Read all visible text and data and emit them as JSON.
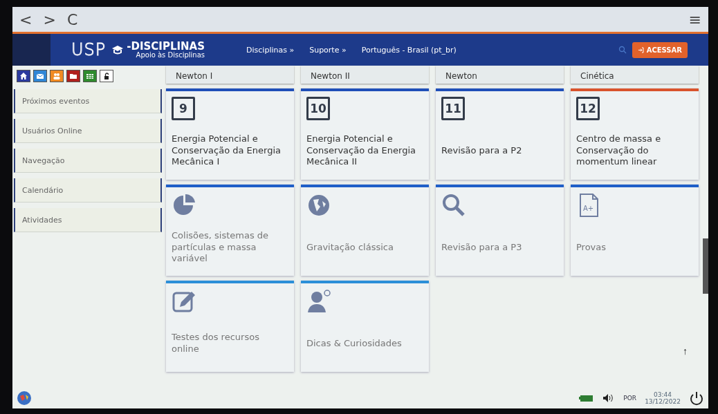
{
  "browser": {
    "back": "<",
    "forward": ">",
    "reload": "C",
    "menu": "≡"
  },
  "header": {
    "logo": "USP",
    "brand": "-DISCIPLINAS",
    "tagline": "Apoio às Disciplinas",
    "menu": [
      "Disciplinas »",
      "Suporte »",
      "Português - Brasil (pt_br)"
    ],
    "login": "ACESSAR"
  },
  "quick_buttons": [
    {
      "kind": "home",
      "color": "#2b3a9e"
    },
    {
      "kind": "mail",
      "color": "#2f86d6"
    },
    {
      "kind": "people",
      "color": "#f08a24"
    },
    {
      "kind": "folder",
      "color": "#b0201e"
    },
    {
      "kind": "table",
      "color": "#2e8b2e"
    },
    {
      "kind": "lock",
      "color": "#ffffff"
    }
  ],
  "sidebar": {
    "blocks": [
      "Próximos eventos",
      "Usuários Online",
      "Navegação",
      "Calendário",
      "Atividades"
    ]
  },
  "partial_tiles": [
    "Newton I",
    "Newton II",
    "Newton",
    "Cinética"
  ],
  "tiles": [
    {
      "kind": "number",
      "number": "9",
      "title": "Energia Potencial e Conservação da Energia Mecânica I",
      "color": "#1f4fb8"
    },
    {
      "kind": "number",
      "number": "10",
      "title": "Energia Potencial e Conservação da Energia Mecânica II",
      "color": "#1f4fb8"
    },
    {
      "kind": "number",
      "number": "11",
      "title": "Revisão para a P2",
      "color": "#1f4fb8"
    },
    {
      "kind": "number",
      "number": "12",
      "title": "Centro de massa e Conservação do momentum linear",
      "color": "#d9532c"
    },
    {
      "kind": "pie",
      "title": "Colisões, sistemas de partículas e massa variável",
      "color": "#1f5fc8"
    },
    {
      "kind": "globe",
      "title": "Gravitação clássica",
      "color": "#1f5fc8"
    },
    {
      "kind": "search",
      "title": "Revisão para a P3",
      "color": "#1f5fc8"
    },
    {
      "kind": "grade",
      "label": "A+",
      "title": "Provas",
      "color": "#1f5fc8"
    },
    {
      "kind": "edit",
      "title": "Testes dos recursos online",
      "color": "#2b8fd8"
    },
    {
      "kind": "person",
      "title": "Dicas & Curiosidades",
      "color": "#2b8fd8"
    }
  ],
  "back_to_top": "↑",
  "taskbar": {
    "language": "POR",
    "time": "03:44",
    "date": "13/12/2022"
  }
}
